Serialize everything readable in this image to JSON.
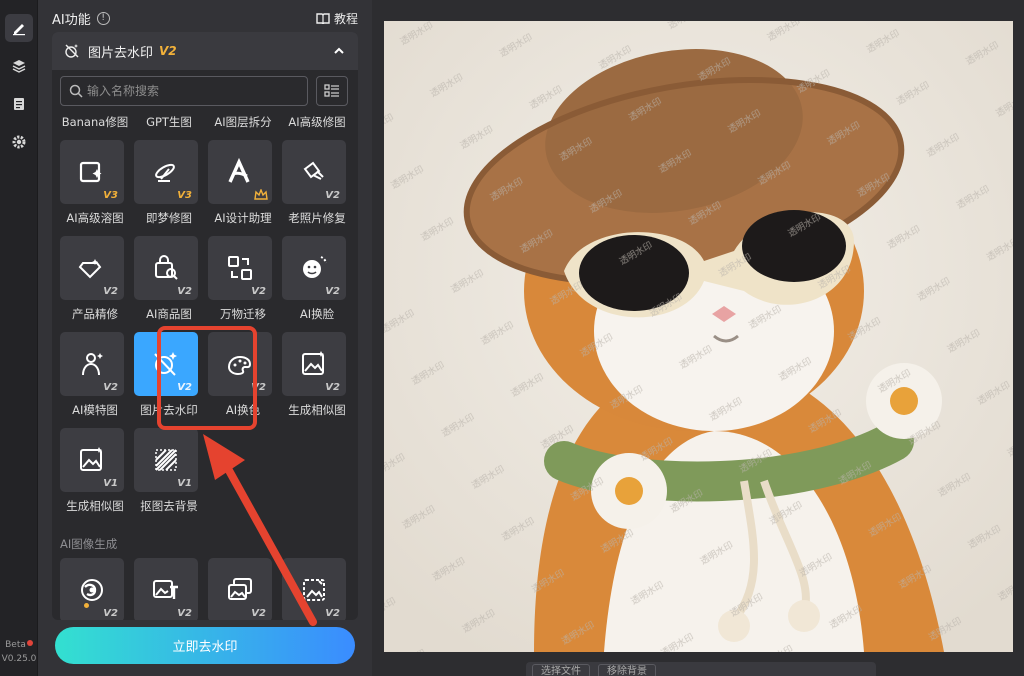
{
  "sidebar": {
    "version_badge": "Beta",
    "version": "V0.25.0"
  },
  "panel": {
    "title": "AI功能",
    "tutorial_label": "教程",
    "tool": {
      "name": "图片去水印",
      "version": "V2"
    },
    "search": {
      "placeholder": "输入名称搜索"
    },
    "top_labels": [
      "Banana修图",
      "GPT生图",
      "AI图层拆分",
      "AI高级修图"
    ],
    "rows": [
      {
        "tiles": [
          {
            "icon": "sparkle-image-icon",
            "version": "V3",
            "gold": true
          },
          {
            "icon": "dream-brush-icon",
            "version": "V3",
            "gold": true
          },
          {
            "icon": "ai-design-letter-icon",
            "version": "",
            "crown": true
          },
          {
            "icon": "photo-restore-icon",
            "version": "V2",
            "gold": false
          }
        ],
        "labels": [
          "AI高级溶图",
          "即梦修图",
          "AI设计助理",
          "老照片修复"
        ]
      },
      {
        "tiles": [
          {
            "icon": "diamond-tag-icon",
            "version": "V2",
            "gold": false
          },
          {
            "icon": "shopping-bag-icon",
            "version": "V2",
            "gold": false
          },
          {
            "icon": "transfer-icon",
            "version": "V2",
            "gold": false
          },
          {
            "icon": "face-swap-icon",
            "version": "V2",
            "gold": false
          }
        ],
        "labels": [
          "产品精修",
          "AI商品图",
          "万物迁移",
          "AI换脸"
        ]
      },
      {
        "tiles": [
          {
            "icon": "model-person-icon",
            "version": "V2",
            "gold": false
          },
          {
            "icon": "watermark-remove-icon",
            "version": "V2",
            "gold": false,
            "selected": true
          },
          {
            "icon": "palette-icon",
            "version": "V2",
            "gold": false
          },
          {
            "icon": "similar-image-icon",
            "version": "V2",
            "gold": false
          }
        ],
        "labels": [
          "AI模特图",
          "图片去水印",
          "AI换色",
          "生成相似图"
        ]
      },
      {
        "tiles": [
          {
            "icon": "similar-image-icon",
            "version": "V1",
            "gold": false
          },
          {
            "icon": "cutout-stripes-icon",
            "version": "V1",
            "gold": false
          }
        ],
        "labels": [
          "生成相似图",
          "抠图去背景"
        ]
      }
    ],
    "section2_title": "AI图像生成",
    "section2_tiles": [
      {
        "icon": "swirl-icon",
        "version": "V2"
      },
      {
        "icon": "image-text-icon",
        "version": "V2"
      },
      {
        "icon": "multi-image-icon",
        "version": "V2"
      },
      {
        "icon": "image-frame-icon",
        "version": "V2"
      }
    ],
    "primary_button": "立即去水印"
  },
  "canvas": {
    "watermark_text": "透明水印",
    "bottom_buttons": [
      "选择文件",
      "移除背景"
    ]
  },
  "colors": {
    "accent_selected": "#3aa7ff",
    "highlight_red": "#e5432f",
    "version_gold": "#f2b13a"
  }
}
